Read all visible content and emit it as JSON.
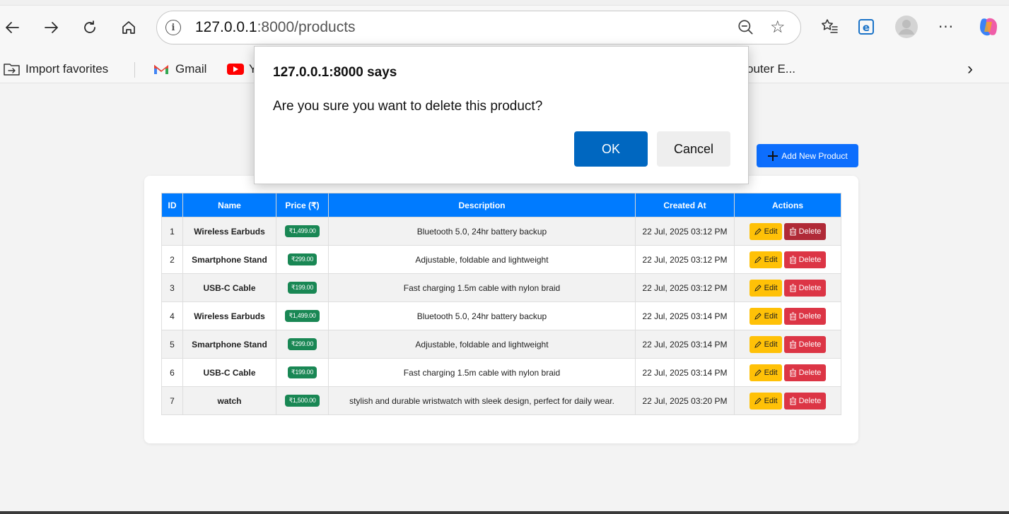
{
  "browser": {
    "url_host": "127.0.0.1",
    "url_rest": ":8000/products",
    "bookmarks": [
      {
        "label": "Import favorites",
        "icon": "import-favorites-icon"
      },
      {
        "label": "Gmail",
        "icon": "gmail-icon"
      },
      {
        "label": "Y",
        "icon": "youtube-icon"
      },
      {
        "label": "outer E...",
        "icon": ""
      }
    ],
    "more_bookmarks_chevron": "›"
  },
  "page": {
    "add_button_label": "Add New Product",
    "columns": [
      "ID",
      "Name",
      "Price (₹)",
      "Description",
      "Created At",
      "Actions"
    ],
    "rows": [
      {
        "id": "1",
        "name": "Wireless Earbuds",
        "price": "₹1,499.00",
        "description": "Bluetooth 5.0, 24hr battery backup",
        "created_at": "22 Jul, 2025 03:12 PM"
      },
      {
        "id": "2",
        "name": "Smartphone Stand",
        "price": "₹299.00",
        "description": "Adjustable, foldable and lightweight",
        "created_at": "22 Jul, 2025 03:12 PM"
      },
      {
        "id": "3",
        "name": "USB-C Cable",
        "price": "₹199.00",
        "description": "Fast charging 1.5m cable with nylon braid",
        "created_at": "22 Jul, 2025 03:12 PM"
      },
      {
        "id": "4",
        "name": "Wireless Earbuds",
        "price": "₹1,499.00",
        "description": "Bluetooth 5.0, 24hr battery backup",
        "created_at": "22 Jul, 2025 03:14 PM"
      },
      {
        "id": "5",
        "name": "Smartphone Stand",
        "price": "₹299.00",
        "description": "Adjustable, foldable and lightweight",
        "created_at": "22 Jul, 2025 03:14 PM"
      },
      {
        "id": "6",
        "name": "USB-C Cable",
        "price": "₹199.00",
        "description": "Fast charging 1.5m cable with nylon braid",
        "created_at": "22 Jul, 2025 03:14 PM"
      },
      {
        "id": "7",
        "name": "watch",
        "price": "₹1,500.00",
        "description": "stylish and durable wristwatch with sleek design, perfect for daily wear.",
        "created_at": "22 Jul, 2025 03:20 PM"
      }
    ],
    "edit_label": "Edit",
    "delete_label": "Delete"
  },
  "dialog": {
    "title": "127.0.0.1:8000 says",
    "message": "Are you sure you want to delete this product?",
    "ok_label": "OK",
    "cancel_label": "Cancel"
  },
  "colors": {
    "primary": "#007bff",
    "edit": "#ffc107",
    "delete": "#dc3545",
    "price_badge": "#198754",
    "dialog_ok": "#0067c0"
  }
}
